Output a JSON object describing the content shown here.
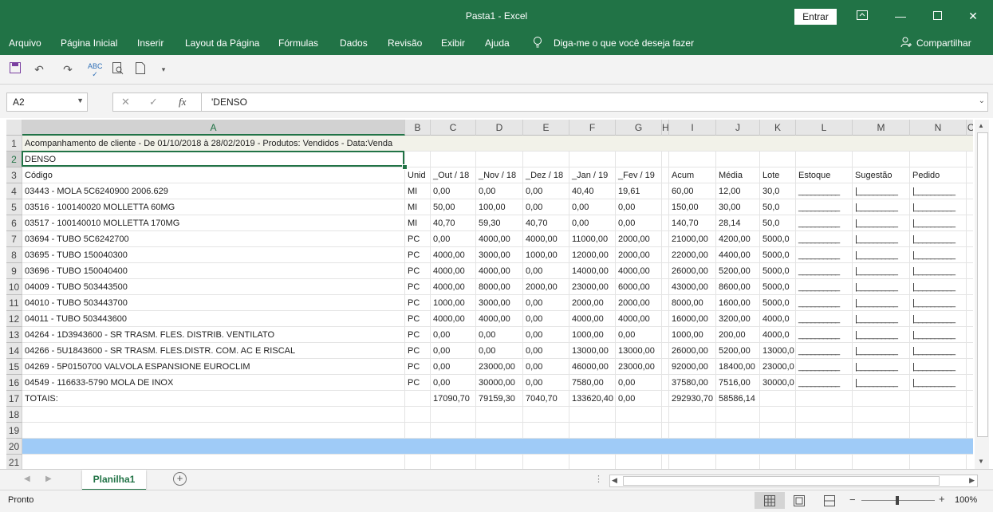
{
  "window": {
    "title": "Pasta1  -  Excel",
    "signin_label": "Entrar"
  },
  "ribbon": {
    "tabs": [
      "Arquivo",
      "Página Inicial",
      "Inserir",
      "Layout da Página",
      "Fórmulas",
      "Dados",
      "Revisão",
      "Exibir",
      "Ajuda"
    ],
    "tell_me": "Diga-me o que você deseja fazer",
    "share_label": "Compartilhar"
  },
  "formula_bar": {
    "name_box": "A2",
    "formula": "'DENSO",
    "fx_label": "fx"
  },
  "sheet": {
    "columns": [
      "A",
      "B",
      "C",
      "D",
      "E",
      "F",
      "G",
      "H",
      "I",
      "J",
      "K",
      "L",
      "M",
      "N",
      "O"
    ],
    "rows": [
      [
        "Acompanhamento de cliente - De 01/10/2018 à 28/02/2019 - Produtos: Vendidos - Data:Venda",
        "",
        "",
        "",
        "",
        "",
        "",
        "",
        "",
        "",
        "",
        "",
        "",
        "",
        ""
      ],
      [
        "DENSO",
        "",
        "",
        "",
        "",
        "",
        "",
        "",
        "",
        "",
        "",
        "",
        "",
        "",
        ""
      ],
      [
        "Código",
        "Unid",
        "_Out / 18",
        "_Nov / 18",
        "_Dez / 18",
        "_Jan / 19",
        "_Fev / 19",
        "",
        "Acum",
        "Média",
        "Lote",
        "Estoque",
        "Sugestão",
        "Pedido",
        ""
      ],
      [
        "03443 - MOLA 5C6240900  2006.629",
        "MI",
        "0,00",
        "0,00",
        "0,00",
        "40,40",
        "19,61",
        "",
        "60,00",
        "12,00",
        "30,0",
        "__________",
        "|__________",
        "|__________",
        ""
      ],
      [
        "03516 - 100140020 MOLLETTA 60MG",
        "MI",
        "50,00",
        "100,00",
        "0,00",
        "0,00",
        "0,00",
        "",
        "150,00",
        "30,00",
        "50,0",
        "__________",
        "|__________",
        "|__________",
        ""
      ],
      [
        "03517 - 100140010 MOLLETTA 170MG",
        "MI",
        "40,70",
        "59,30",
        "40,70",
        "0,00",
        "0,00",
        "",
        "140,70",
        "28,14",
        "50,0",
        "__________",
        "|__________",
        "|__________",
        ""
      ],
      [
        "03694 - TUBO 5C6242700",
        "PC",
        "0,00",
        "4000,00",
        "4000,00",
        "11000,00",
        "2000,00",
        "",
        "21000,00",
        "4200,00",
        "5000,0",
        "__________",
        "|__________",
        "|__________",
        ""
      ],
      [
        "03695 - TUBO 150040300",
        "PC",
        "4000,00",
        "3000,00",
        "1000,00",
        "12000,00",
        "2000,00",
        "",
        "22000,00",
        "4400,00",
        "5000,0",
        "__________",
        "|__________",
        "|__________",
        ""
      ],
      [
        "03696 - TUBO 150040400",
        "PC",
        "4000,00",
        "4000,00",
        "0,00",
        "14000,00",
        "4000,00",
        "",
        "26000,00",
        "5200,00",
        "5000,0",
        "__________",
        "|__________",
        "|__________",
        ""
      ],
      [
        "04009 - TUBO 503443500",
        "PC",
        "4000,00",
        "8000,00",
        "2000,00",
        "23000,00",
        "6000,00",
        "",
        "43000,00",
        "8600,00",
        "5000,0",
        "__________",
        "|__________",
        "|__________",
        ""
      ],
      [
        "04010 - TUBO 503443700",
        "PC",
        "1000,00",
        "3000,00",
        "0,00",
        "2000,00",
        "2000,00",
        "",
        "8000,00",
        "1600,00",
        "5000,0",
        "__________",
        "|__________",
        "|__________",
        ""
      ],
      [
        "04011 - TUBO 503443600",
        "PC",
        "4000,00",
        "4000,00",
        "0,00",
        "4000,00",
        "4000,00",
        "",
        "16000,00",
        "3200,00",
        "4000,0",
        "__________",
        "|__________",
        "|__________",
        ""
      ],
      [
        "04264 - 1D3943600 - SR TRASM. FLES. DISTRIB. VENTILATO",
        "PC",
        "0,00",
        "0,00",
        "0,00",
        "1000,00",
        "0,00",
        "",
        "1000,00",
        "200,00",
        "4000,0",
        "__________",
        "|__________",
        "|__________",
        ""
      ],
      [
        "04266 - 5U1843600 - SR TRASM. FLES.DISTR. COM. AC E RISCAL",
        "PC",
        "0,00",
        "0,00",
        "0,00",
        "13000,00",
        "13000,00",
        "",
        "26000,00",
        "5200,00",
        "13000,0",
        "__________",
        "|__________",
        "|__________",
        ""
      ],
      [
        "04269 - 5P0150700 VALVOLA ESPANSIONE EUROCLIM",
        "PC",
        "0,00",
        "23000,00",
        "0,00",
        "46000,00",
        "23000,00",
        "",
        "92000,00",
        "18400,00",
        "23000,0",
        "__________",
        "|__________",
        "|__________",
        ""
      ],
      [
        "04549 - 116633-5790 MOLA DE INOX",
        "PC",
        "0,00",
        "30000,00",
        "0,00",
        "7580,00",
        "0,00",
        "",
        "37580,00",
        "7516,00",
        "30000,0",
        "__________",
        "|__________",
        "|__________",
        ""
      ],
      [
        "TOTAIS:",
        "",
        "17090,70",
        "79159,30",
        "7040,70",
        "133620,40",
        "0,00",
        "",
        "292930,70",
        "58586,14",
        "",
        "",
        "",
        "",
        ""
      ],
      [
        "",
        "",
        "",
        "",
        "",
        "",
        "",
        "",
        "",
        "",
        "",
        "",
        "",
        "",
        ""
      ],
      [
        "",
        "",
        "",
        "",
        "",
        "",
        "",
        "",
        "",
        "",
        "",
        "",
        "",
        "",
        ""
      ],
      [
        "",
        "",
        "",
        "",
        "",
        "",
        "",
        "",
        "",
        "",
        "",
        "",
        "",
        "",
        ""
      ],
      [
        "",
        "",
        "",
        "",
        "",
        "",
        "",
        "",
        "",
        "",
        "",
        "",
        "",
        "",
        ""
      ]
    ],
    "highlight_row": 20,
    "tab_name": "Planilha1"
  },
  "status": {
    "text": "Pronto",
    "zoom": "100%"
  },
  "colors": {
    "excel_green": "#217346",
    "selected_row": "#9fcbf7",
    "row1_fill": "#f2f2e9"
  }
}
